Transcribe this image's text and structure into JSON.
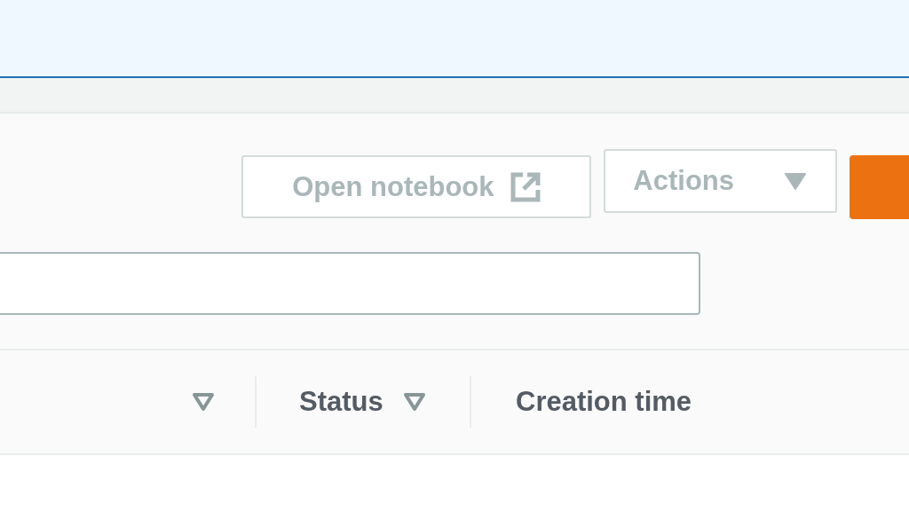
{
  "toolbar": {
    "buttons": [
      {
        "kind": "external",
        "label": "Open notebook",
        "disabled": true
      },
      {
        "kind": "dropdown",
        "label": "Actions",
        "disabled": true
      },
      {
        "kind": "primary",
        "disabled": false
      }
    ]
  },
  "table": {
    "columns": [
      {
        "sortable": true
      },
      {
        "label": "Status",
        "sortable": true
      },
      {
        "label": "Creation time",
        "sortable": false
      }
    ]
  }
}
